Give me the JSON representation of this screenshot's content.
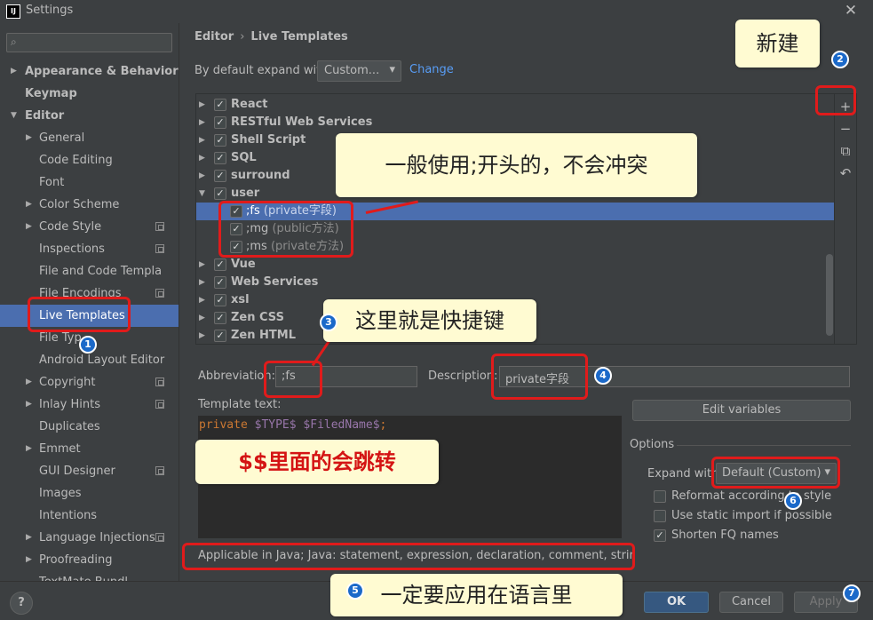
{
  "window": {
    "title": "Settings",
    "logo": "IJ"
  },
  "search": {
    "placeholder": ""
  },
  "sidebar": {
    "items": [
      {
        "label": "Appearance & Behavior"
      },
      {
        "label": "Keymap"
      },
      {
        "label": "Editor"
      },
      {
        "label": "General"
      },
      {
        "label": "Code Editing"
      },
      {
        "label": "Font"
      },
      {
        "label": "Color Scheme"
      },
      {
        "label": "Code Style"
      },
      {
        "label": "Inspections"
      },
      {
        "label": "File and Code Templa"
      },
      {
        "label": "File Encodings"
      },
      {
        "label": "Live Templates"
      },
      {
        "label": "File Typ"
      },
      {
        "label": "Android Layout Editor"
      },
      {
        "label": "Copyright"
      },
      {
        "label": "Inlay Hints"
      },
      {
        "label": "Duplicates"
      },
      {
        "label": "Emmet"
      },
      {
        "label": "GUI Designer"
      },
      {
        "label": "Images"
      },
      {
        "label": "Intentions"
      },
      {
        "label": "Language Injections"
      },
      {
        "label": "Proofreading"
      },
      {
        "label": "TextMate Bundl"
      }
    ]
  },
  "breadcrumb": {
    "parent": "Editor",
    "sep": "›",
    "current": "Live Templates"
  },
  "expand": {
    "label": "By default expand with",
    "value": "Custom...",
    "change_link": "Change"
  },
  "templates": {
    "groups": [
      {
        "name": "React"
      },
      {
        "name": "RESTful Web Services"
      },
      {
        "name": "Shell Script"
      },
      {
        "name": "SQL"
      },
      {
        "name": "surround"
      },
      {
        "name": "user"
      },
      {
        "name": "Vue"
      },
      {
        "name": "Web Services"
      },
      {
        "name": "xsl"
      },
      {
        "name": "Zen CSS"
      },
      {
        "name": "Zen HTML"
      }
    ],
    "user_items": [
      {
        "abbr": ";fs",
        "desc": "(private字段)"
      },
      {
        "abbr": ";mg",
        "desc": "(public方法)"
      },
      {
        "abbr": ";ms",
        "desc": "(private方法)"
      }
    ],
    "tools": {
      "add": "+",
      "remove": "−",
      "copy": "⧉",
      "revert": "↶"
    }
  },
  "form": {
    "abbr_label": "Abbreviation:",
    "abbr_value": ";fs",
    "desc_label": "Description:",
    "desc_value": "private字段",
    "template_label": "Template text:",
    "template_code": {
      "kw": "private",
      "v1": "$TYPE$",
      "v2": "$FiledName$",
      "end": ";"
    },
    "edit_vars": "Edit variables",
    "options_label": "Options",
    "expand_with_label": "Expand with",
    "expand_with_value": "Default (Custom)",
    "opt1": "Reformat according to style",
    "opt2": "Use static import if possible",
    "opt3": "Shorten FQ names",
    "applicable": "Applicable in Java; Java: statement, expression, declaration, comment, string, smar"
  },
  "buttons": {
    "help": "?",
    "ok": "OK",
    "cancel": "Cancel",
    "apply": "Apply"
  },
  "annotations": {
    "new": "新建",
    "usage": "一般使用;开头的，不会冲突",
    "shortcut": "这里就是快捷键",
    "jump": "$$里面的会跳转",
    "language": "一定要应用在语言里",
    "badges": [
      "1",
      "2",
      "3",
      "4",
      "5",
      "6",
      "7"
    ]
  }
}
